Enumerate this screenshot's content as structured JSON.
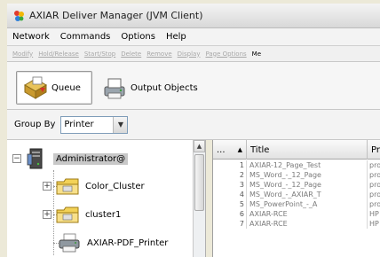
{
  "window": {
    "title": "AXIAR Deliver Manager (JVM Client)"
  },
  "menubar": {
    "items": [
      {
        "label": "Network"
      },
      {
        "label": "Commands"
      },
      {
        "label": "Options"
      },
      {
        "label": "Help"
      }
    ]
  },
  "actionbar": {
    "items": [
      {
        "label": "Modify"
      },
      {
        "label": "Hold/Release"
      },
      {
        "label": "Start/Stop"
      },
      {
        "label": "Delete"
      },
      {
        "label": "Remove"
      },
      {
        "label": "Display"
      },
      {
        "label": "Page Options"
      },
      {
        "label": "Me"
      }
    ]
  },
  "tabs": {
    "queue": "Queue",
    "output": "Output Objects"
  },
  "groupby": {
    "label": "Group By",
    "value": "Printer"
  },
  "tree": {
    "root": "Administrator@",
    "children": [
      {
        "label": "Color_Cluster"
      },
      {
        "label": "cluster1"
      },
      {
        "label": "AXIAR-PDF_Printer"
      }
    ]
  },
  "table": {
    "headers": {
      "num": "...",
      "title": "Title",
      "pr": "Pr"
    },
    "rows": [
      {
        "n": "1",
        "title": "AXIAR-12_Page_Test",
        "pr": "pro"
      },
      {
        "n": "2",
        "title": "MS_Word_-_12_Page",
        "pr": "pro"
      },
      {
        "n": "3",
        "title": "MS_Word_-_12_Page",
        "pr": "pro"
      },
      {
        "n": "4",
        "title": "MS_Word_-_AXIAR_T",
        "pr": "pro"
      },
      {
        "n": "5",
        "title": "MS_PowerPoint_-_A",
        "pr": "pro"
      },
      {
        "n": "6",
        "title": "AXIAR-RCE",
        "pr": "HP"
      },
      {
        "n": "7",
        "title": "AXIAR-RCE",
        "pr": "HP"
      }
    ]
  },
  "icons": {
    "app": "app-logo-icon",
    "queue": "queue-icon",
    "output": "output-objects-icon",
    "server": "server-icon",
    "folder": "folder-icon",
    "printer": "printer-icon"
  }
}
